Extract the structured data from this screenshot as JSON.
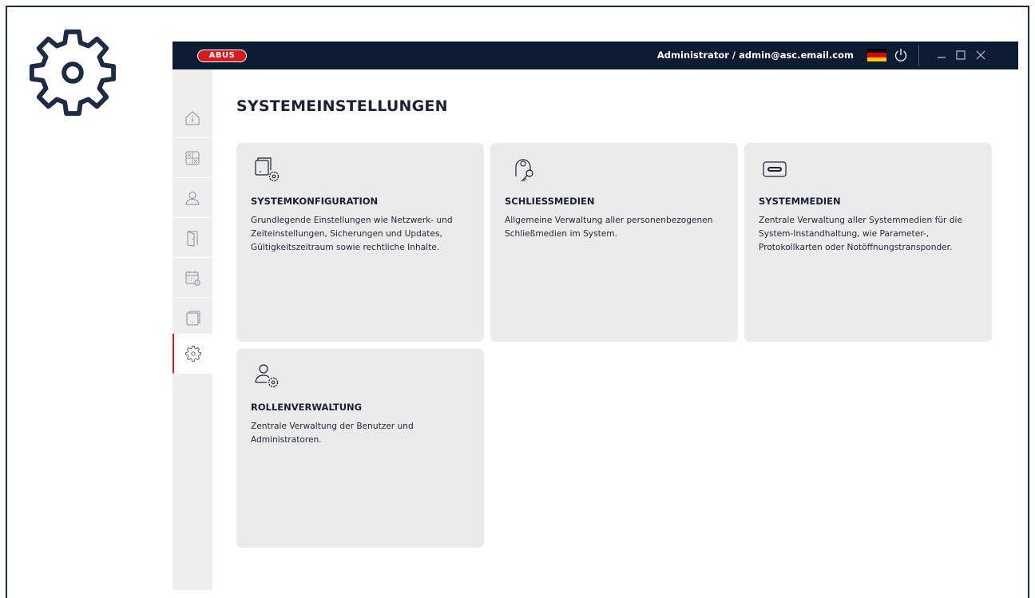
{
  "app": {
    "logo": "ABUS",
    "user": "Administrator / admin@asc.email.com",
    "flag_colors": [
      "#000000",
      "#dd0000",
      "#ffce00"
    ],
    "accent": "#d71920",
    "titlebar_color": "#0d1b33"
  },
  "sidebar": {
    "items": [
      {
        "name": "info",
        "icon": "home-info-icon"
      },
      {
        "name": "grid",
        "icon": "grid-icon"
      },
      {
        "name": "persons",
        "icon": "person-icon"
      },
      {
        "name": "doors",
        "icon": "door-icon"
      },
      {
        "name": "calendar",
        "icon": "calendar-icon"
      },
      {
        "name": "media",
        "icon": "card-icon"
      },
      {
        "name": "settings",
        "icon": "gear-icon",
        "active": true
      }
    ]
  },
  "main": {
    "title": "SYSTEMEINSTELLUNGEN",
    "cards": [
      {
        "icon": "card-gear-icon",
        "title": "SYSTEMKONFIGURATION",
        "desc": "Grundlegende Einstellungen wie Netzwerk- und Zeiteinstellungen, Sicherungen und Updates, Gültigkeitszeitraum sowie rechtliche Inhalte."
      },
      {
        "icon": "key-icon",
        "title": "SCHLIESSMEDIEN",
        "desc": "Allgemeine Verwaltung aller personenbezogenen Schließmedien im System."
      },
      {
        "icon": "abus-card-icon",
        "title": "SYSTEMMEDIEN",
        "desc": "Zentrale Verwaltung aller Systemmedien für die System-Instandhaltung, wie Parameter-, Protokollkarten oder Notöffnungstransponder."
      },
      {
        "icon": "user-gear-icon",
        "title": "ROLLENVERWALTUNG",
        "desc": "Zentrale Verwaltung der Benutzer und Administratoren."
      }
    ]
  }
}
